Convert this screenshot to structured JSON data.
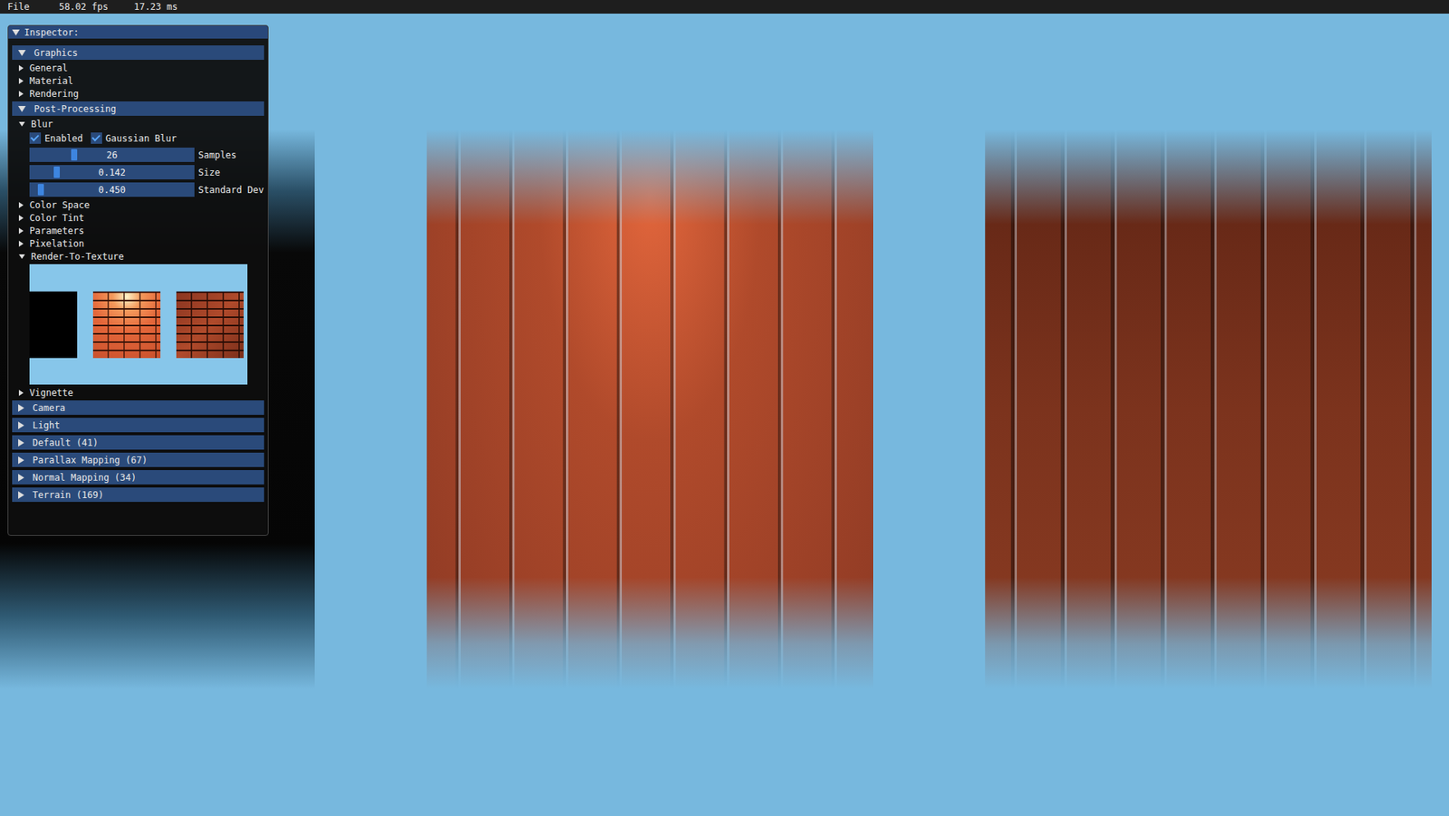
{
  "menu_bar": {
    "items": [
      "File"
    ],
    "fps": "58.02 fps",
    "frame_time": "17.23 ms"
  },
  "viewport": {
    "panels": [
      {
        "kind": "dark"
      },
      {
        "kind": "lit-brick"
      },
      {
        "kind": "shaded-brick"
      }
    ]
  },
  "inspector": {
    "title": "Inspector:",
    "expanded": true,
    "tree": [
      {
        "kind": "header",
        "label": "Graphics",
        "expanded": true,
        "children": [
          {
            "kind": "node",
            "label": "General",
            "expanded": false
          },
          {
            "kind": "node",
            "label": "Material",
            "expanded": false
          },
          {
            "kind": "node",
            "label": "Rendering",
            "expanded": false
          },
          {
            "kind": "header",
            "label": "Post-Processing",
            "expanded": true,
            "children": [
              {
                "kind": "node",
                "label": "Blur",
                "expanded": true,
                "children": [
                  {
                    "kind": "checkboxes",
                    "items": [
                      {
                        "label": "Enabled",
                        "checked": true
                      },
                      {
                        "label": "Gaussian Blur",
                        "checked": true
                      }
                    ]
                  },
                  {
                    "kind": "slider",
                    "label": "Samples",
                    "value": "26",
                    "level": 0.26
                  },
                  {
                    "kind": "slider",
                    "label": "Size",
                    "value": "0.142",
                    "level": 0.15
                  },
                  {
                    "kind": "slider",
                    "label": "Standard Dev",
                    "value": "0.450",
                    "level": 0.05
                  }
                ]
              },
              {
                "kind": "node",
                "label": "Color Space",
                "expanded": false
              },
              {
                "kind": "node",
                "label": "Color Tint",
                "expanded": false
              },
              {
                "kind": "node",
                "label": "Parameters",
                "expanded": false
              },
              {
                "kind": "node",
                "label": "Pixelation",
                "expanded": false
              },
              {
                "kind": "node",
                "label": "Render-To-Texture",
                "expanded": true,
                "children": [
                  {
                    "kind": "preview",
                    "thumbnails": [
                      {
                        "kind": "black"
                      },
                      {
                        "kind": "lit-brick"
                      },
                      {
                        "kind": "shaded-brick"
                      }
                    ]
                  }
                ]
              },
              {
                "kind": "node",
                "label": "Vignette",
                "expanded": false
              }
            ]
          }
        ]
      },
      {
        "kind": "header",
        "label": "Camera",
        "expanded": false
      },
      {
        "kind": "header",
        "label": "Light",
        "expanded": false
      },
      {
        "kind": "header",
        "label": "Default (41)",
        "expanded": false
      },
      {
        "kind": "header",
        "label": "Parallax Mapping (67)",
        "expanded": false
      },
      {
        "kind": "header",
        "label": "Normal Mapping (34)",
        "expanded": false
      },
      {
        "kind": "header",
        "label": "Terrain (169)",
        "expanded": false
      }
    ]
  }
}
